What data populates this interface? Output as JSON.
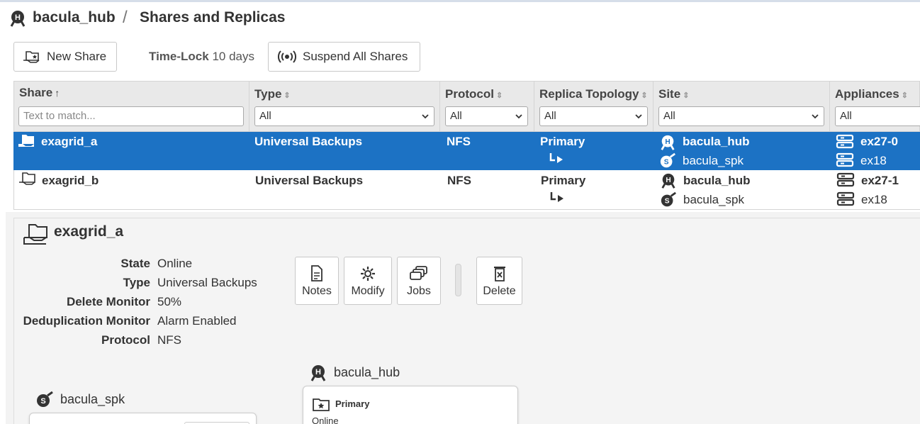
{
  "header": {
    "hub": "bacula_hub",
    "separator": "/",
    "page_title": "Shares and Replicas"
  },
  "toolbar": {
    "new_share_label": "New Share",
    "timelock_label": "Time-Lock",
    "timelock_value": "10 days",
    "suspend_label": "Suspend All Shares"
  },
  "table": {
    "columns": [
      {
        "label": "Share",
        "sort": "↑"
      },
      {
        "label": "Type",
        "sort": "⇕"
      },
      {
        "label": "Protocol",
        "sort": "⇕"
      },
      {
        "label": "Replica Topology",
        "sort": "⇕"
      },
      {
        "label": "Site",
        "sort": "⇕"
      },
      {
        "label": "Appliances",
        "sort": "⇕"
      }
    ],
    "filters": {
      "share_placeholder": "Text to match...",
      "type": "All",
      "protocol": "All",
      "topology": "All",
      "site": "All",
      "appliances": "All"
    },
    "rows": [
      {
        "share": "exagrid_a",
        "type": "Universal Backups",
        "protocol": "NFS",
        "topology": "Primary",
        "site1": "bacula_hub",
        "site2": "bacula_spk",
        "app1": "ex27-0",
        "app2": "ex18",
        "selected": true
      },
      {
        "share": "exagrid_b",
        "type": "Universal Backups",
        "protocol": "NFS",
        "topology": "Primary",
        "site1": "bacula_hub",
        "site2": "bacula_spk",
        "app1": "ex27-1",
        "app2": "ex18",
        "selected": false
      }
    ]
  },
  "detail": {
    "title": "exagrid_a",
    "props": [
      {
        "key": "State",
        "value": "Online"
      },
      {
        "key": "Type",
        "value": "Universal Backups"
      },
      {
        "key": "Delete Monitor",
        "value": "50%"
      },
      {
        "key": "Deduplication Monitor",
        "value": "Alarm Enabled"
      },
      {
        "key": "Protocol",
        "value": "NFS"
      }
    ],
    "actions": {
      "notes": "Notes",
      "modify": "Modify",
      "jobs": "Jobs",
      "delete": "Delete"
    },
    "topology": {
      "hub_label": "bacula_hub",
      "spk_label": "bacula_spk",
      "primary_title": "Primary",
      "primary_state": "Online"
    }
  },
  "colors": {
    "selected_row": "#1c72c4",
    "header_bg": "#e9e9e9"
  }
}
